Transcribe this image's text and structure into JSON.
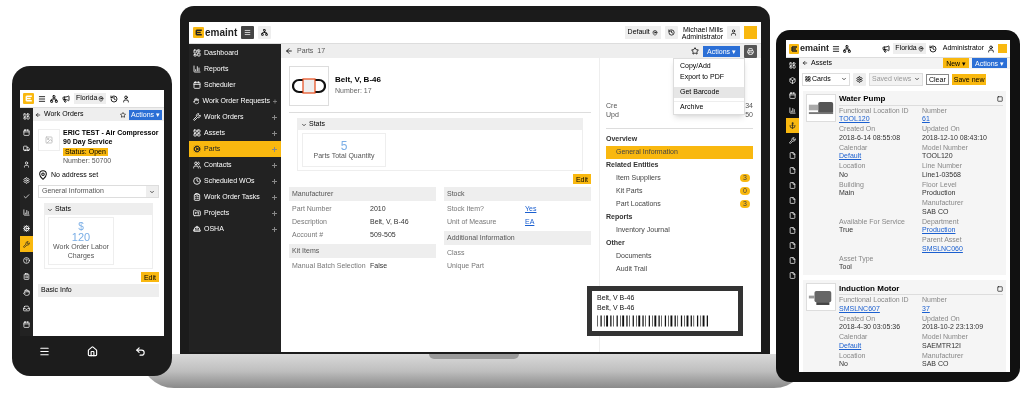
{
  "laptop": {
    "header": {
      "logo": "emaint",
      "location": "Default",
      "user_name": "Michael Mills",
      "user_role": "Administrator"
    },
    "sidebar": [
      {
        "label": "Dashboard",
        "selected": false,
        "expandable": false
      },
      {
        "label": "Reports",
        "selected": false,
        "expandable": false
      },
      {
        "label": "Scheduler",
        "selected": false,
        "expandable": false
      },
      {
        "label": "Work Order Requests",
        "selected": false,
        "expandable": true
      },
      {
        "label": "Work Orders",
        "selected": false,
        "expandable": true
      },
      {
        "label": "Assets",
        "selected": false,
        "expandable": true
      },
      {
        "label": "Parts",
        "selected": true,
        "expandable": true
      },
      {
        "label": "Contacts",
        "selected": false,
        "expandable": true
      },
      {
        "label": "Scheduled WOs",
        "selected": false,
        "expandable": true
      },
      {
        "label": "Work Order Tasks",
        "selected": false,
        "expandable": true
      },
      {
        "label": "Projects",
        "selected": false,
        "expandable": true
      },
      {
        "label": "OSHA",
        "selected": false,
        "expandable": true
      }
    ],
    "breadcrumb": {
      "module": "Parts",
      "record": "17"
    },
    "actions_button": "Actions ▾",
    "menu": [
      {
        "label": "Copy/Add",
        "selected": false
      },
      {
        "label": "Export to PDF",
        "selected": false
      },
      {
        "label": "Get Barcode",
        "selected": true
      },
      {
        "label": "Archive",
        "selected": false
      }
    ],
    "record": {
      "title": "Belt, V, B-46",
      "number": "Number: 17",
      "created_label": "Cre",
      "created_value": "34",
      "updated_label": "Upd",
      "updated_value": "50"
    },
    "stats": {
      "title": "Stats",
      "value": "5",
      "label": "Parts Total Quantity"
    },
    "edit_button": "Edit",
    "left_sections": [
      {
        "title": "Manufacturer",
        "fields": [
          {
            "label": "Part Number",
            "value": "2010",
            "link": false
          },
          {
            "label": "Description",
            "value": "Belt, V, B-46",
            "link": false
          },
          {
            "label": "Account #",
            "value": "509-505",
            "link": false
          }
        ]
      },
      {
        "title": "Kit Items",
        "fields": [
          {
            "label": "Manual Batch Selection",
            "value": "False",
            "link": false
          }
        ]
      }
    ],
    "right_sections": [
      {
        "title": "Stock",
        "fields": [
          {
            "label": "Stock Item?",
            "value": "Yes",
            "link": true
          },
          {
            "label": "Unit of Measure",
            "value": "EA",
            "link": true
          }
        ]
      },
      {
        "title": "Additional Information",
        "fields": [
          {
            "label": "Class"
          },
          {
            "label": "Unique Part"
          }
        ]
      }
    ],
    "nav": [
      {
        "heading": "Overview",
        "items": [
          {
            "label": "General Information",
            "selected": true
          }
        ]
      },
      {
        "heading": "Related Entities",
        "items": [
          {
            "label": "Item Suppliers",
            "count": "3",
            "selected": false
          },
          {
            "label": "Kit Parts",
            "count": "0",
            "selected": false
          },
          {
            "label": "Part Locations",
            "count": "3",
            "selected": false
          }
        ]
      },
      {
        "heading": "Reports",
        "items": [
          {
            "label": "Inventory Journal",
            "selected": false
          }
        ]
      },
      {
        "heading": "Other",
        "items": [
          {
            "label": "Documents",
            "selected": false
          },
          {
            "label": "Audit Trail",
            "selected": false
          }
        ]
      }
    ],
    "barcode": {
      "lines": [
        "Belt, V B-46",
        "Belt, V B-46"
      ]
    }
  },
  "phone": {
    "header": {
      "location": "Florida"
    },
    "sidebar": [
      {
        "selected": false
      },
      {
        "selected": false
      },
      {
        "selected": false
      },
      {
        "selected": false
      },
      {
        "selected": false
      },
      {
        "selected": false
      },
      {
        "selected": false
      },
      {
        "selected": false
      },
      {
        "selected": true
      },
      {
        "selected": false
      },
      {
        "selected": false
      },
      {
        "selected": false
      },
      {
        "selected": false
      },
      {
        "selected": false
      }
    ],
    "breadcrumb": "Work Orders",
    "actions_button": "Actions ▾",
    "record": {
      "title": "ERIC TEST - Air Compressor 90 Day Service",
      "status": "Status: Open",
      "number": "Number: 50700"
    },
    "address": "No address set",
    "section_select": "General Information",
    "stats": {
      "title": "Stats",
      "currency": "$",
      "value": "120",
      "label": "Work Order Labor Charges"
    },
    "edit_button": "Edit",
    "section": "Basic Info"
  },
  "tablet": {
    "header": {
      "logo": "emaint",
      "location": "Florida",
      "user_role": "Administrator"
    },
    "sidebar": [
      {
        "selected": false
      },
      {
        "selected": false
      },
      {
        "selected": false
      },
      {
        "selected": false
      },
      {
        "selected": true
      },
      {
        "selected": false
      },
      {
        "selected": false
      },
      {
        "selected": false
      },
      {
        "selected": false
      },
      {
        "selected": false
      },
      {
        "selected": false
      },
      {
        "selected": false
      },
      {
        "selected": false
      },
      {
        "selected": false
      },
      {
        "selected": false
      }
    ],
    "breadcrumb": "Assets",
    "new_button": "New ▾",
    "actions_button": "Actions ▾",
    "view_select": "Cards",
    "saved_views": {
      "placeholder": "Saved views"
    },
    "clear_button": "Clear",
    "save_button": "Save new",
    "cards": [
      {
        "kind": "pump",
        "title": "Water Pump",
        "rows": [
          {
            "left": {
              "label": "Functional Location ID",
              "value": "TOOL120",
              "link": true
            },
            "right": {
              "label": "Number",
              "value": "61",
              "link": true
            }
          },
          {
            "left": {
              "label": "Created On",
              "value": "2018-6-14 08:55:08",
              "link": false
            },
            "right": {
              "label": "Updated On",
              "value": "2018-12-10 08:43:10",
              "link": false
            }
          },
          {
            "left": {
              "label": "Calendar",
              "value": "Default",
              "link": true
            },
            "right": {
              "label": "Model Number",
              "value": "TOOL120",
              "link": false
            }
          },
          {
            "left": {
              "label": "Location",
              "value": "No",
              "link": false
            },
            "right": {
              "label": "Line Number",
              "value": "Line1-03568",
              "link": false
            }
          },
          {
            "left": {
              "label": "Building",
              "value": "Main",
              "link": false
            },
            "right": {
              "label": "Floor Level",
              "value": "Production",
              "link": false
            }
          },
          {
            "right": {
              "label": "Manufacturer",
              "value": "SAB CO",
              "link": false
            }
          },
          {
            "left": {
              "label": "Available For Service",
              "value": "True",
              "link": false
            },
            "right": {
              "label": "Department",
              "value": "Production",
              "link": true
            }
          },
          {
            "right": {
              "label": "Parent Asset",
              "value": "SMSLNC060",
              "link": true
            }
          },
          {
            "left": {
              "label": "Asset Type",
              "value": "Tool",
              "link": false
            }
          }
        ]
      },
      {
        "kind": "motor",
        "title": "Induction Motor",
        "rows": [
          {
            "left": {
              "label": "Functional Location ID",
              "value": "SMSLNC607",
              "link": true
            },
            "right": {
              "label": "Number",
              "value": "37",
              "link": true
            }
          },
          {
            "left": {
              "label": "Created On",
              "value": "2018-4-30 03:05:36",
              "link": false
            },
            "right": {
              "label": "Updated On",
              "value": "2018-10-2 23:13:09",
              "link": false
            }
          },
          {
            "left": {
              "label": "Calendar",
              "value": "Default",
              "link": true
            },
            "right": {
              "label": "Model Number",
              "value": "SAEMTR12I",
              "link": false
            }
          },
          {
            "left": {
              "label": "Location",
              "value": "No",
              "link": false
            },
            "right": {
              "label": "Manufacturer",
              "value": "SAB CO",
              "link": false
            }
          }
        ]
      }
    ]
  }
}
